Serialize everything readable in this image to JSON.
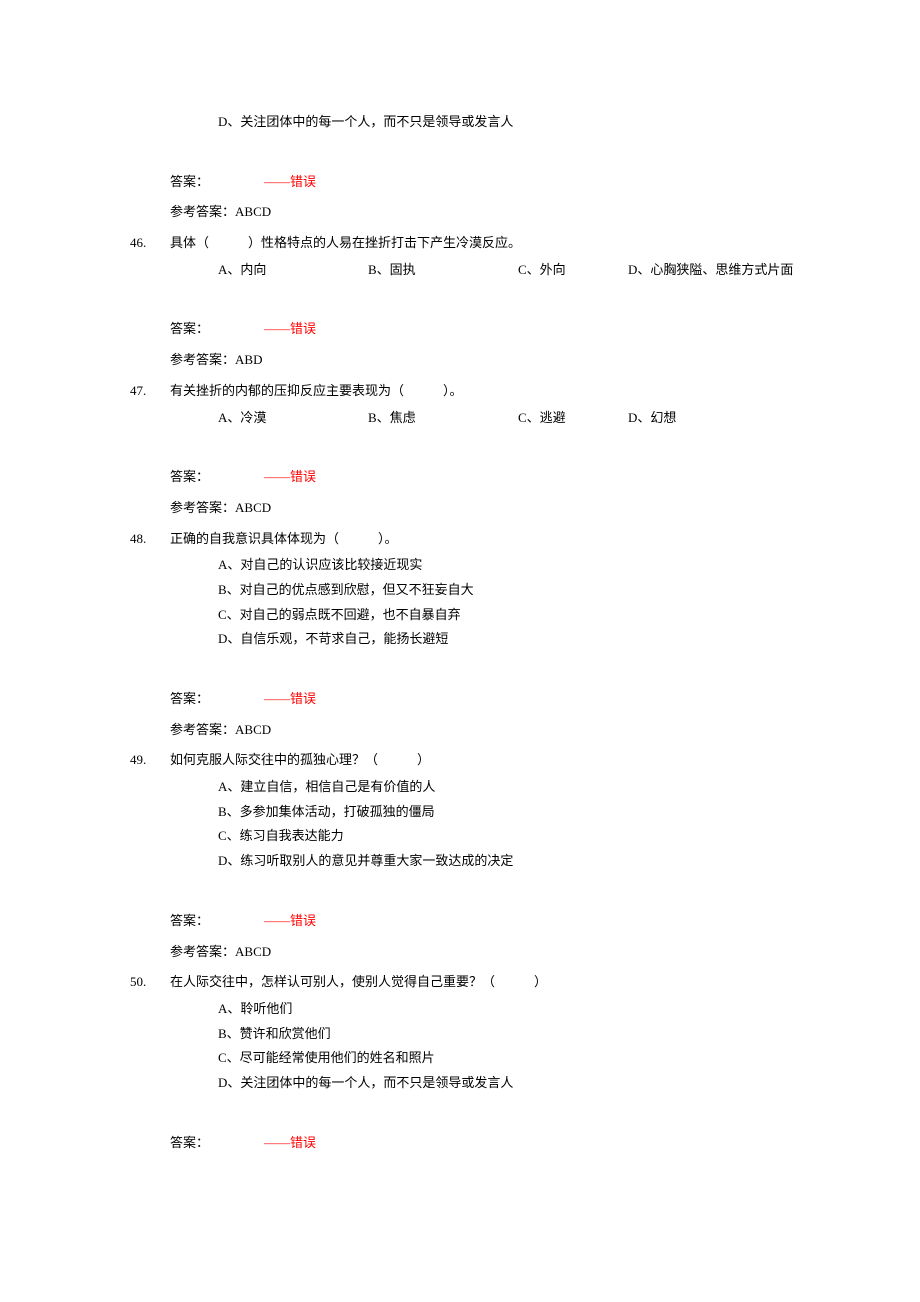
{
  "trailing_option_d": "D、关注团体中的每一个人，而不只是领导或发言人",
  "labels": {
    "answer": "答案：",
    "wrong": "——错误",
    "ref_prefix": "参考答案："
  },
  "prev_answer": {
    "ref": "ABCD"
  },
  "q46": {
    "num": "46.",
    "text": "具体（　　　）性格特点的人易在挫折打击下产生冷漠反应。",
    "a": "A、内向",
    "b": "B、固执",
    "c": "C、外向",
    "d": "D、心胸狭隘、思维方式片面",
    "ref": "ABD"
  },
  "q47": {
    "num": "47.",
    "text": "有关挫折的内郁的压抑反应主要表现为（　　　）。",
    "a": "A、冷漠",
    "b": "B、焦虑",
    "c": "C、逃避",
    "d": "D、幻想",
    "ref": "ABCD"
  },
  "q48": {
    "num": "48.",
    "text": "正确的自我意识具体体现为（　　　）。",
    "a": "A、对自己的认识应该比较接近现实",
    "b": "B、对自己的优点感到欣慰，但又不狂妄自大",
    "c": "C、对自己的弱点既不回避，也不自暴自弃",
    "d": "D、自信乐观，不苛求自己，能扬长避短",
    "ref": "ABCD"
  },
  "q49": {
    "num": "49.",
    "text": "如何克服人际交往中的孤独心理？（　　　）",
    "a": "A、建立自信，相信自己是有价值的人",
    "b": "B、多参加集体活动，打破孤独的僵局",
    "c": "C、练习自我表达能力",
    "d": "D、练习听取别人的意见并尊重大家一致达成的决定",
    "ref": "ABCD"
  },
  "q50": {
    "num": "50.",
    "text": "在人际交往中，怎样认可别人，使别人觉得自己重要？（　　　）",
    "a": "A、聆听他们",
    "b": "B、赞许和欣赏他们",
    "c": "C、尽可能经常使用他们的姓名和照片",
    "d": "D、关注团体中的每一个人，而不只是领导或发言人"
  }
}
